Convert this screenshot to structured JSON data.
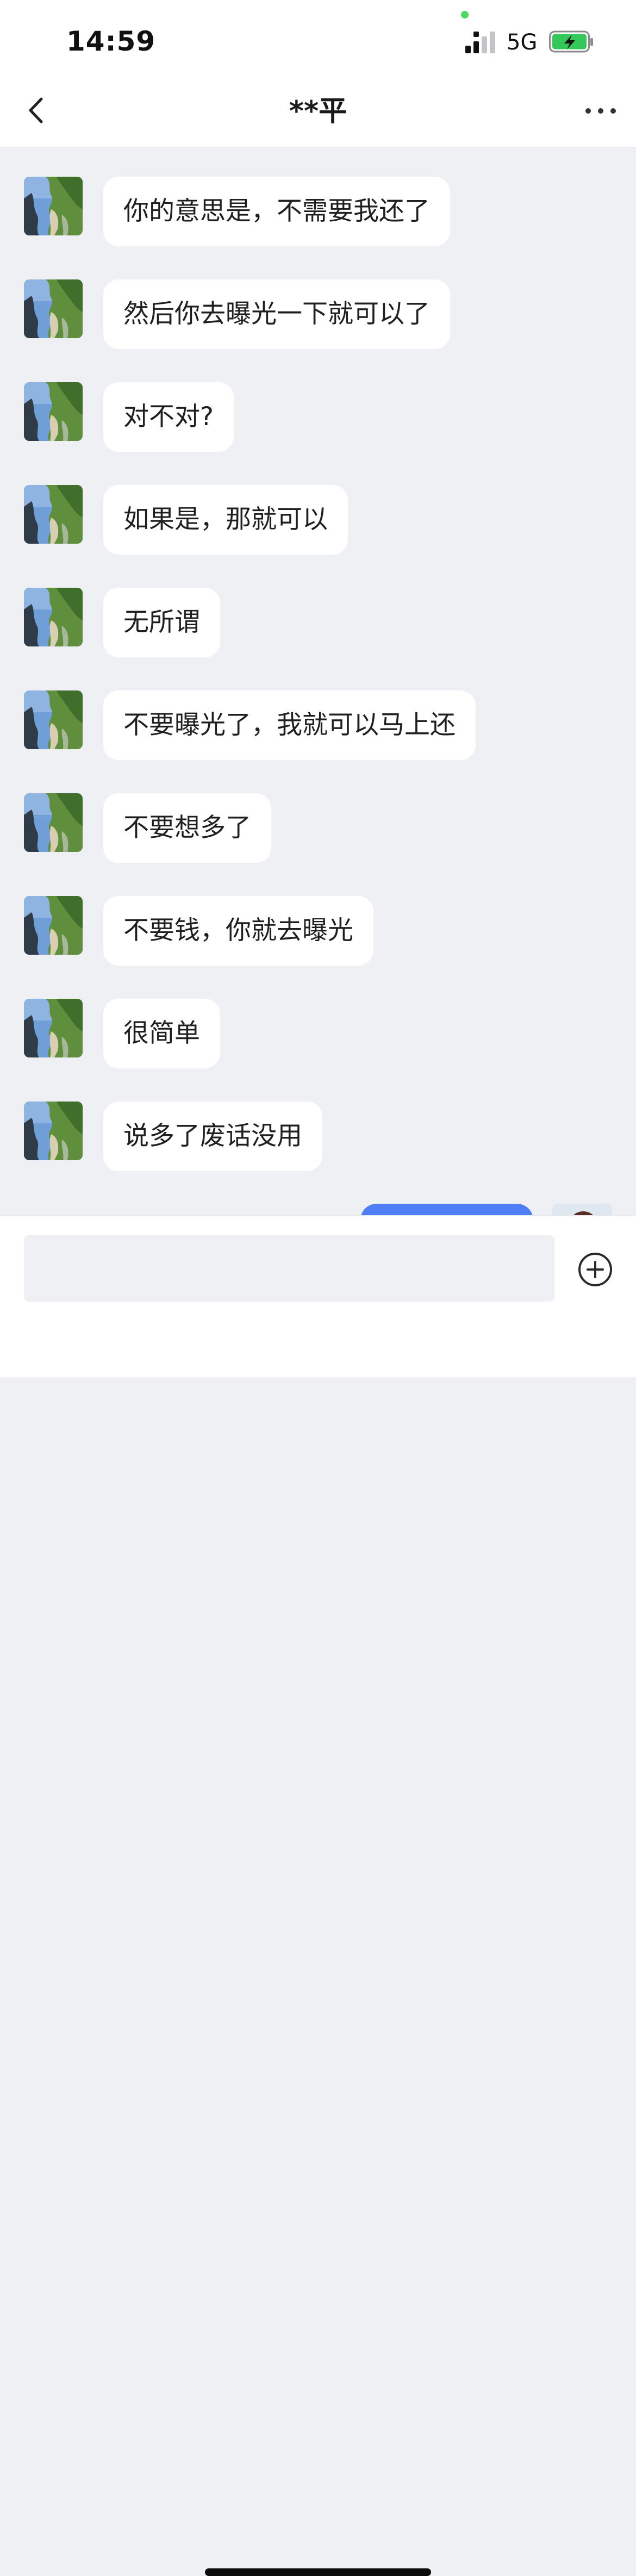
{
  "status_bar": {
    "time": "14:59",
    "network": "5G",
    "dot_color": "#4cd964",
    "battery_color": "#34c759"
  },
  "chat": {
    "title": "**平"
  },
  "messages": [
    {
      "text": "你的意思是，不需要我还了"
    },
    {
      "text": "然后你去曝光一下就可以了"
    },
    {
      "text": "对不对?"
    },
    {
      "text": "如果是，那就可以"
    },
    {
      "text": "无所谓"
    },
    {
      "text": "不要曝光了，我就可以马上还"
    },
    {
      "text": "不要想多了"
    },
    {
      "text": "不要钱，你就去曝光"
    },
    {
      "text": "很简单"
    },
    {
      "text": "说多了废话没用"
    }
  ],
  "outgoing": {
    "bubble_color": "#4f7ef7"
  },
  "input": {
    "placeholder": ""
  },
  "icons": {
    "back": "chevron-left-icon",
    "more": "more-horizontal-icon",
    "add": "plus-circle-icon"
  }
}
